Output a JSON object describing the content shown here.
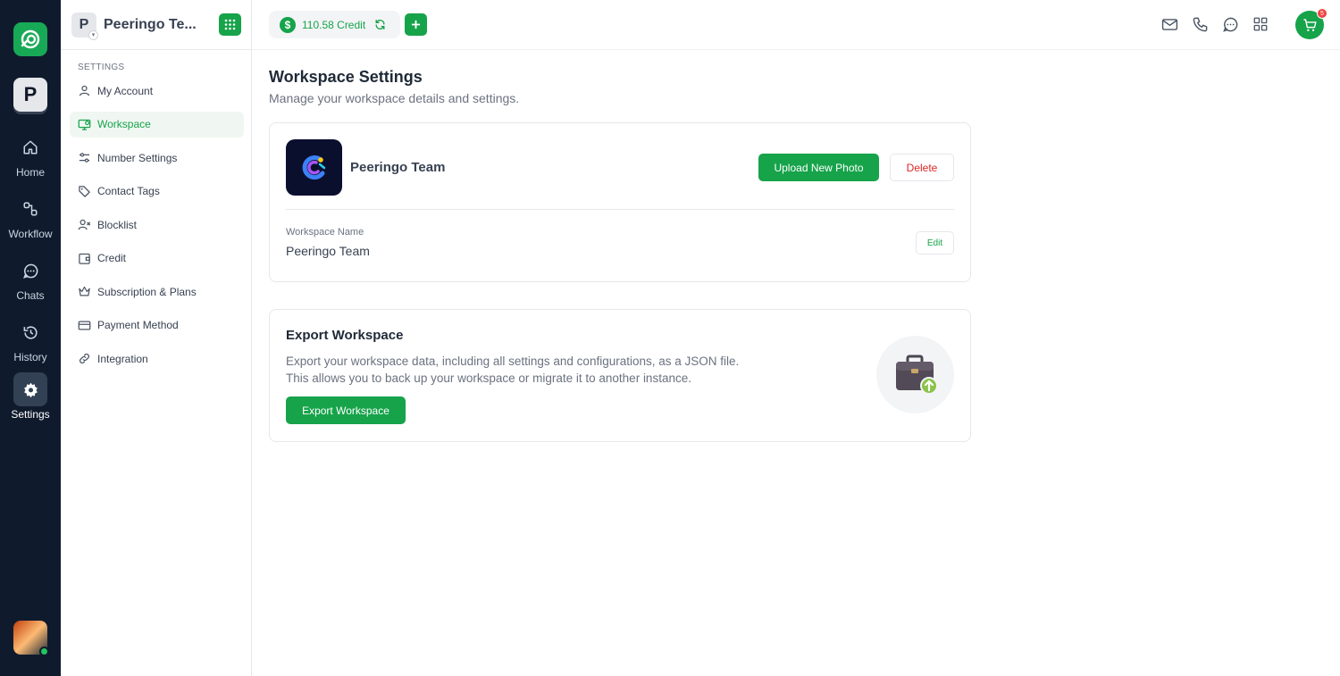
{
  "rail": {
    "workspace_initial": "P",
    "items": [
      {
        "label": "Home",
        "icon": "home-icon"
      },
      {
        "label": "Workflow",
        "icon": "workflow-icon"
      },
      {
        "label": "Chats",
        "icon": "chat-icon"
      },
      {
        "label": "History",
        "icon": "history-icon"
      },
      {
        "label": "Settings",
        "icon": "gear-icon",
        "active": true
      }
    ]
  },
  "sidebar": {
    "workspace_initial": "P",
    "workspace_name": "Peeringo Te...",
    "section_label": "SETTINGS",
    "items": [
      {
        "label": "My Account",
        "icon": "user-icon"
      },
      {
        "label": "Workspace",
        "icon": "workspace-icon",
        "active": true
      },
      {
        "label": "Number Settings",
        "icon": "sliders-icon"
      },
      {
        "label": "Contact Tags",
        "icon": "tag-icon"
      },
      {
        "label": "Blocklist",
        "icon": "user-block-icon"
      },
      {
        "label": "Credit",
        "icon": "wallet-icon"
      },
      {
        "label": "Subscription & Plans",
        "icon": "crown-icon"
      },
      {
        "label": "Payment Method",
        "icon": "card-icon"
      },
      {
        "label": "Integration",
        "icon": "link-icon"
      }
    ]
  },
  "topbar": {
    "credit_symbol": "$",
    "credit_label": "110.58 Credit",
    "cart_badge": "5",
    "icons": [
      "mail-icon",
      "phone-icon",
      "chat-icon",
      "apps-grid-icon"
    ]
  },
  "main": {
    "title": "Workspace Settings",
    "subtitle": "Manage your workspace details and settings.",
    "profile": {
      "name": "Peeringo Team",
      "upload_label": "Upload New Photo",
      "delete_label": "Delete",
      "field_label": "Workspace Name",
      "field_value": "Peeringo Team",
      "edit_label": "Edit"
    },
    "export": {
      "title": "Export Workspace",
      "desc_line1": "Export your workspace data, including all settings and configurations, as a JSON file.",
      "desc_line2": "This allows you to back up your workspace or migrate it to another instance.",
      "button_label": "Export Workspace"
    }
  },
  "colors": {
    "accent": "#16a34a",
    "rail_bg": "#0f1b2d",
    "danger": "#dc2626"
  }
}
